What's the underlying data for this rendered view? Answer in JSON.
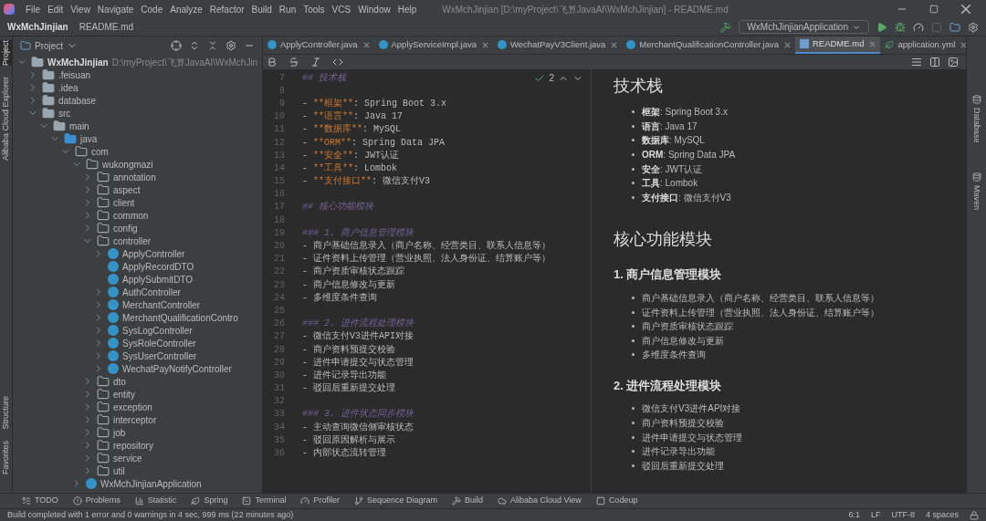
{
  "menu_bar": {
    "items": [
      "File",
      "Edit",
      "View",
      "Navigate",
      "Code",
      "Analyze",
      "Refactor",
      "Build",
      "Run",
      "Tools",
      "VCS",
      "Window",
      "Help"
    ],
    "title": "WxMchJinjian [D:\\myProject\\飞算JavaAI\\WxMchJinjian] - README.md"
  },
  "nav_bar": {
    "breadcrumbs": [
      "WxMchJinjian",
      "README.md"
    ],
    "run_config": "WxMchJinjianApplication"
  },
  "left_strip": [
    {
      "label": "Project",
      "selected": true
    },
    {
      "label": "Alibaba Cloud Explorer",
      "selected": false
    },
    {
      "label": "Structure",
      "selected": false
    },
    {
      "label": "Favorites",
      "selected": false
    }
  ],
  "project_panel": {
    "title": "Project",
    "tree": [
      {
        "label": "WxMchJinjian",
        "path": "D:\\myProject\\飞算JavaAI\\WxMchJin",
        "kind": "project",
        "expanded": true,
        "children": [
          {
            "label": ".feisuan",
            "kind": "folder",
            "expanded": false
          },
          {
            "label": ".idea",
            "kind": "folder",
            "expanded": false
          },
          {
            "label": "database",
            "kind": "folder",
            "expanded": false
          },
          {
            "label": "src",
            "kind": "folder",
            "expanded": true,
            "children": [
              {
                "label": "main",
                "kind": "folder",
                "expanded": true,
                "children": [
                  {
                    "label": "java",
                    "kind": "source",
                    "expanded": true,
                    "children": [
                      {
                        "label": "com",
                        "kind": "package",
                        "expanded": true,
                        "children": [
                          {
                            "label": "wukongmazi",
                            "kind": "package",
                            "expanded": true,
                            "children": [
                              {
                                "label": "annotation",
                                "kind": "package",
                                "expanded": false
                              },
                              {
                                "label": "aspect",
                                "kind": "package",
                                "expanded": false
                              },
                              {
                                "label": "client",
                                "kind": "package",
                                "expanded": false
                              },
                              {
                                "label": "common",
                                "kind": "package",
                                "expanded": false
                              },
                              {
                                "label": "config",
                                "kind": "package",
                                "expanded": false
                              },
                              {
                                "label": "controller",
                                "kind": "package",
                                "expanded": true,
                                "children": [
                                  {
                                    "label": "ApplyController",
                                    "kind": "class",
                                    "expanded": false
                                  },
                                  {
                                    "label": "ApplyRecordDTO",
                                    "kind": "leaf-class"
                                  },
                                  {
                                    "label": "ApplySubmitDTO",
                                    "kind": "leaf-class"
                                  },
                                  {
                                    "label": "AuthController",
                                    "kind": "class",
                                    "expanded": false
                                  },
                                  {
                                    "label": "MerchantController",
                                    "kind": "class",
                                    "expanded": false
                                  },
                                  {
                                    "label": "MerchantQualificationContro",
                                    "kind": "class",
                                    "expanded": false
                                  },
                                  {
                                    "label": "SysLogController",
                                    "kind": "class",
                                    "expanded": false
                                  },
                                  {
                                    "label": "SysRoleController",
                                    "kind": "class",
                                    "expanded": false
                                  },
                                  {
                                    "label": "SysUserController",
                                    "kind": "class",
                                    "expanded": false
                                  },
                                  {
                                    "label": "WechatPayNotifyController",
                                    "kind": "class",
                                    "expanded": false
                                  }
                                ]
                              },
                              {
                                "label": "dto",
                                "kind": "package",
                                "expanded": false
                              },
                              {
                                "label": "entity",
                                "kind": "package",
                                "expanded": false
                              },
                              {
                                "label": "exception",
                                "kind": "package",
                                "expanded": false
                              },
                              {
                                "label": "interceptor",
                                "kind": "package",
                                "expanded": false
                              },
                              {
                                "label": "job",
                                "kind": "package",
                                "expanded": false
                              },
                              {
                                "label": "repository",
                                "kind": "package",
                                "expanded": false
                              },
                              {
                                "label": "service",
                                "kind": "package",
                                "expanded": false
                              },
                              {
                                "label": "util",
                                "kind": "package",
                                "expanded": false
                              }
                            ]
                          },
                          {
                            "label": "WxMchJinjianApplication",
                            "kind": "app",
                            "expanded": false
                          }
                        ]
                      }
                    ]
                  }
                ]
              }
            ]
          }
        ]
      }
    ]
  },
  "tabs": [
    {
      "label": "ApplyController.java",
      "kind": "java",
      "selected": false
    },
    {
      "label": "ApplyServiceImpl.java",
      "kind": "java",
      "selected": false
    },
    {
      "label": "WechatPayV3Client.java",
      "kind": "java",
      "selected": false
    },
    {
      "label": "MerchantQualificationController.java",
      "kind": "java",
      "selected": false
    },
    {
      "label": "README.md",
      "kind": "md",
      "selected": true
    },
    {
      "label": "application.yml",
      "kind": "yml",
      "selected": false
    }
  ],
  "editor": {
    "inspection_count": "2",
    "lines": [
      {
        "number": "7",
        "kind": "heading",
        "text": "## 技术栈"
      },
      {
        "number": "8",
        "kind": "blank"
      },
      {
        "number": "9",
        "kind": "item",
        "text": "- **框架**: Spring Boot 3.x"
      },
      {
        "number": "10",
        "kind": "item",
        "text": "- **语言**: Java 17"
      },
      {
        "number": "11",
        "kind": "item",
        "text": "- **数据库**: MySQL"
      },
      {
        "number": "12",
        "kind": "item",
        "text": "- **ORM**: Spring Data JPA"
      },
      {
        "number": "13",
        "kind": "item",
        "text": "- **安全**: JWT认证"
      },
      {
        "number": "14",
        "kind": "item",
        "text": "- **工具**: Lombok"
      },
      {
        "number": "15",
        "kind": "item",
        "text": "- **支付接口**: 微信支付V3"
      },
      {
        "number": "16",
        "kind": "blank"
      },
      {
        "number": "17",
        "kind": "heading",
        "text": "## 核心功能模块"
      },
      {
        "number": "18",
        "kind": "blank"
      },
      {
        "number": "19",
        "kind": "heading",
        "text": "### 1. 商户信息管理模块"
      },
      {
        "number": "20",
        "kind": "item",
        "text": "- 商户基础信息录入（商户名称、经营类目、联系人信息等）"
      },
      {
        "number": "21",
        "kind": "item",
        "text": "- 证件资料上传管理（营业执照、法人身份证、结算账户等）"
      },
      {
        "number": "22",
        "kind": "item",
        "text": "- 商户资质审核状态跟踪"
      },
      {
        "number": "23",
        "kind": "item",
        "text": "- 商户信息修改与更新"
      },
      {
        "number": "24",
        "kind": "item",
        "text": "- 多维度条件查询"
      },
      {
        "number": "25",
        "kind": "blank"
      },
      {
        "number": "26",
        "kind": "heading",
        "text": "### 2. 进件流程处理模块"
      },
      {
        "number": "27",
        "kind": "item",
        "text": "- 微信支付V3进件API对接"
      },
      {
        "number": "28",
        "kind": "item",
        "text": "- 商户资料预提交校验"
      },
      {
        "number": "29",
        "kind": "item",
        "text": "- 进件申请提交与状态管理"
      },
      {
        "number": "30",
        "kind": "item",
        "text": "- 进件记录导出功能"
      },
      {
        "number": "31",
        "kind": "item",
        "text": "- 驳回后重新提交处理"
      },
      {
        "number": "32",
        "kind": "blank"
      },
      {
        "number": "33",
        "kind": "heading",
        "text": "### 3. 进件状态同步模块"
      },
      {
        "number": "34",
        "kind": "item",
        "text": "- 主动查询微信侧审核状态"
      },
      {
        "number": "35",
        "kind": "item",
        "text": "- 驳回原因解析与展示"
      },
      {
        "number": "36",
        "kind": "item",
        "text": "- 内部状态流转管理"
      }
    ]
  },
  "preview": {
    "blocks": [
      {
        "kind": "h1",
        "text": "技术栈"
      },
      {
        "kind": "list",
        "items": [
          "**框架**: Spring Boot 3.x",
          "**语言**: Java 17",
          "**数据库**: MySQL",
          "**ORM**: Spring Data JPA",
          "**安全**: JWT认证",
          "**工具**: Lombok",
          "**支付接口**: 微信支付V3"
        ]
      },
      {
        "kind": "h1",
        "text": "核心功能模块"
      },
      {
        "kind": "h2",
        "text": "1. 商户信息管理模块"
      },
      {
        "kind": "list",
        "items": [
          "商户基础信息录入（商户名称、经营类目、联系人信息等）",
          "证件资料上传管理（营业执照、法人身份证、结算账户等）",
          "商户资质审核状态跟踪",
          "商户信息修改与更新",
          "多维度条件查询"
        ]
      },
      {
        "kind": "h2",
        "text": "2. 进件流程处理模块"
      },
      {
        "kind": "list",
        "items": [
          "微信支付V3进件API对接",
          "商户资料预提交校验",
          "进件申请提交与状态管理",
          "进件记录导出功能",
          "驳回后重新提交处理"
        ]
      }
    ]
  },
  "right_strip": [
    "Database",
    "Maven"
  ],
  "tool_windows": [
    "TODO",
    "Problems",
    "Statistic",
    "Spring",
    "Terminal",
    "Profiler",
    "Sequence Diagram",
    "Build",
    "Alibaba Cloud View",
    "Codeup"
  ],
  "status_bar": {
    "message": "Build completed with 1 error and 0 warnings in 4 sec, 999 ms (22 minutes ago)",
    "items": [
      "6:1",
      "LF",
      "UTF-8",
      "4 spaces"
    ]
  }
}
